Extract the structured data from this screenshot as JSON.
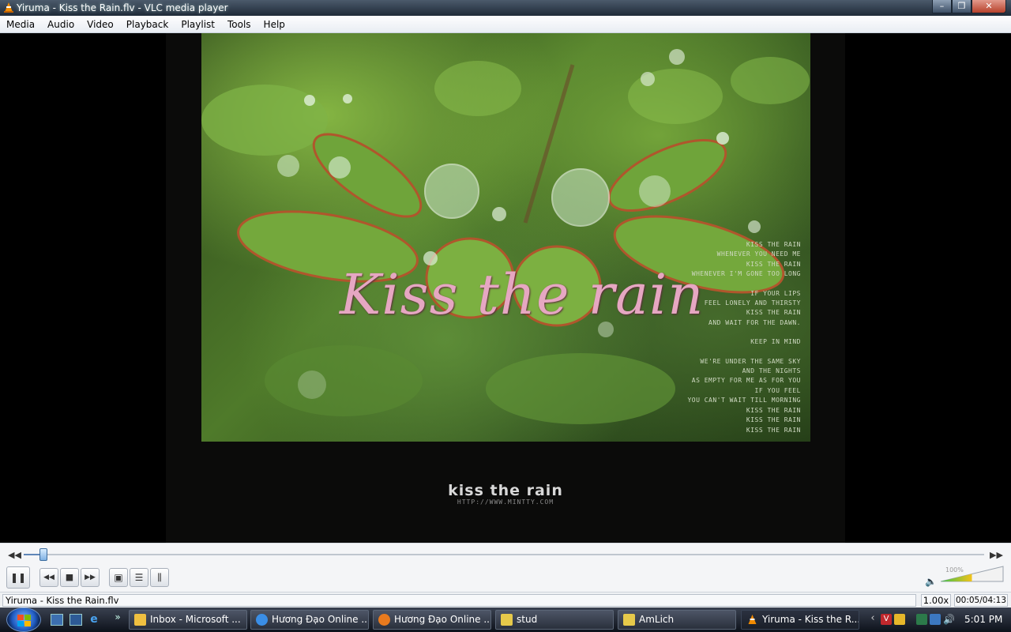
{
  "window": {
    "title": "Yiruma - Kiss the Rain.flv - VLC media player",
    "buttons": {
      "minimize": "–",
      "maximize": "❐",
      "close": "✕"
    }
  },
  "menu": [
    "Media",
    "Audio",
    "Video",
    "Playback",
    "Playlist",
    "Tools",
    "Help"
  ],
  "video": {
    "title_text": "Kiss the rain",
    "lyrics": [
      "KISS THE RAIN",
      "WHENEVER YOU NEED ME",
      "KISS THE RAIN",
      "WHENEVER I'M GONE  TOO LONG",
      "",
      "IF YOUR LIPS",
      "FEEL LONELY AND THIRSTY",
      "KISS THE RAIN",
      "AND WAIT FOR THE DAWN.",
      "",
      "KEEP IN MIND",
      "",
      "WE'RE UNDER THE SAME SKY",
      "AND THE NIGHTS",
      "AS EMPTY FOR ME  AS FOR YOU",
      "IF YOU FEEL",
      "YOU CAN'T WAIT TILL MORNING",
      "KISS THE RAIN",
      "KISS THE RAIN",
      "KISS THE RAIN"
    ],
    "caption": "kiss the rain",
    "url": "HTTP://WWW.MINTTY.COM"
  },
  "controls": {
    "seek_back": "◀◀",
    "seek_forward": "▶▶",
    "seek_progress": 0.0204,
    "pause": "❚❚",
    "prev": "◀◀",
    "stop": "■",
    "next": "▶▶",
    "fullscreen": "▣",
    "playlist": "☰",
    "extended": "⫼",
    "volume_icon": "🔈",
    "volume_percent": "100%",
    "volume_level": 1.0
  },
  "status": {
    "file": "Yiruma - Kiss the Rain.flv",
    "speed": "1.00x",
    "time": "00:05/04:13"
  },
  "taskbar": {
    "quicklaunch_more": "»",
    "buttons": [
      {
        "label": "Inbox - Microsoft ...",
        "icon_color": "#f0c040"
      },
      {
        "label": "Hương Đạo Online ...",
        "icon_color": "#3a8ee6"
      },
      {
        "label": "Hương Đạo Online ...",
        "icon_color": "#e87a1e"
      },
      {
        "label": "stud",
        "icon_color": "#e6c94a"
      },
      {
        "label": "AmLich",
        "icon_color": "#e6c94a"
      },
      {
        "label": "Yiruma - Kiss the R...",
        "icon_color": "#f08a00"
      }
    ],
    "tray_chevron": "‹",
    "clock": "5:01 PM"
  }
}
